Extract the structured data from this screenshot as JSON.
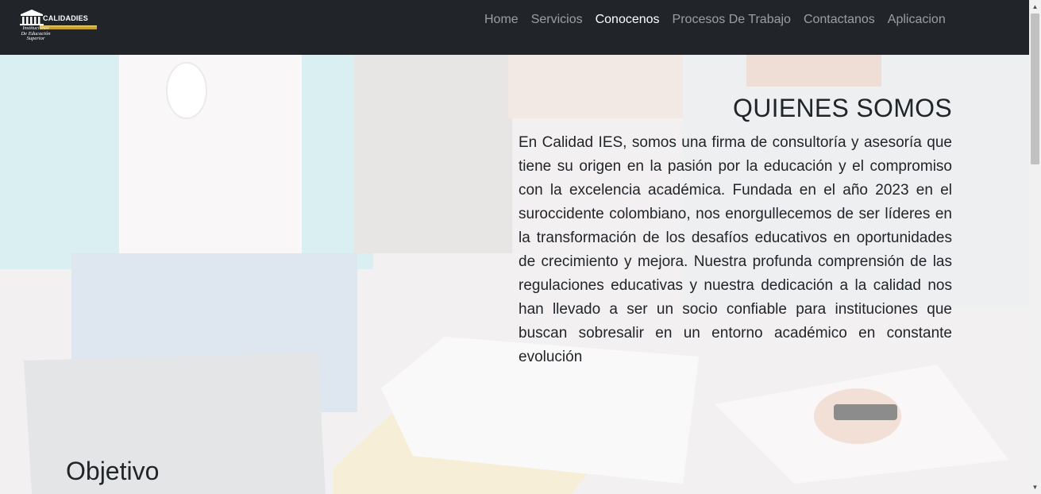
{
  "logo": {
    "brand": "CALIDADIES",
    "tagline": [
      "Instituciones",
      "De Educación",
      "Superior"
    ]
  },
  "nav": {
    "items": [
      {
        "label": "Home",
        "active": false
      },
      {
        "label": "Servicios",
        "active": false
      },
      {
        "label": "Conocenos",
        "active": true
      },
      {
        "label": "Procesos De Trabajo",
        "active": false
      },
      {
        "label": "Contactanos",
        "active": false
      },
      {
        "label": "Aplicacion",
        "active": false
      }
    ]
  },
  "about": {
    "title": "QUIENES SOMOS",
    "body": "En Calidad IES, somos una firma de consultoría y asesoría que tiene su origen en la pasión por la educación y el compromiso con la excelencia académica. Fundada en el año 2023 en el suroccidente colombiano, nos enorgullecemos de ser líderes en la transformación de los desafíos educativos en oportunidades de crecimiento y mejora. Nuestra profunda comprensión de las regulaciones educativas y nuestra dedicación a la calidad nos han llevado a ser un socio confiable para instituciones que buscan sobresalir en un entorno académico en constante evolución"
  },
  "objective": {
    "title": "Objetivo"
  },
  "colors": {
    "navbar_bg": "#212529",
    "nav_link": "rgba(255,255,255,0.55)",
    "nav_link_active": "#ffffff",
    "logo_gold": "#c8a02f",
    "text": "#212529"
  },
  "icons": [
    "university-building-icon",
    "scroll-up-arrow-icon",
    "scroll-down-arrow-icon"
  ]
}
